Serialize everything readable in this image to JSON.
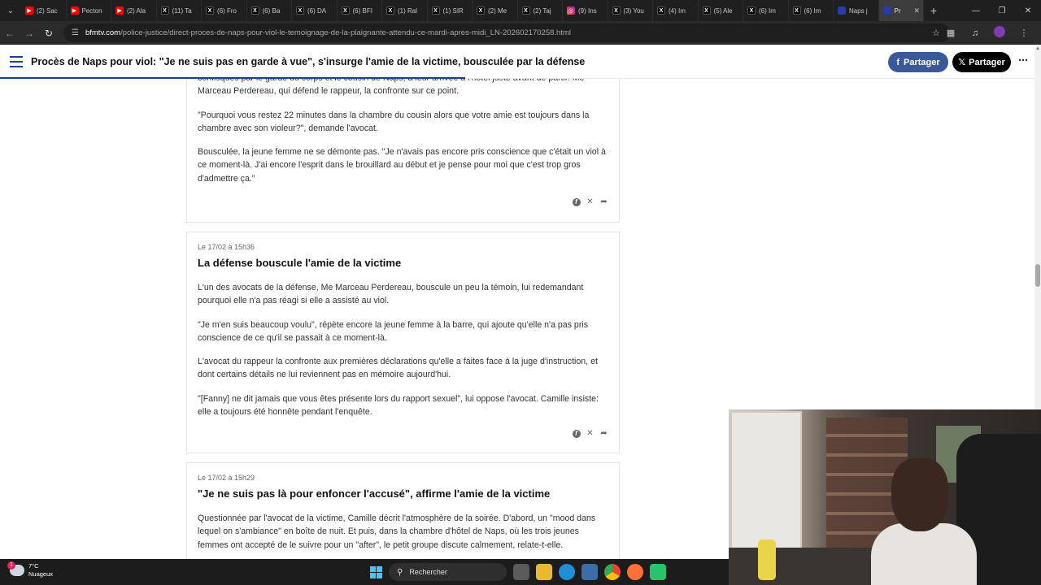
{
  "browser": {
    "tabs": [
      {
        "label": "(2) Sac",
        "favicon": "youtube-icon",
        "active": false
      },
      {
        "label": "Pecton",
        "favicon": "youtube-icon",
        "active": false
      },
      {
        "label": "(2) Ala",
        "favicon": "youtube-icon",
        "active": false
      },
      {
        "label": "(11) Ta",
        "favicon": "x-icon",
        "active": false
      },
      {
        "label": "(6) Fro",
        "favicon": "x-icon",
        "active": false
      },
      {
        "label": "(6) Ba",
        "favicon": "x-icon",
        "active": false
      },
      {
        "label": "(6) DA",
        "favicon": "x-icon",
        "active": false
      },
      {
        "label": "(6) BFI",
        "favicon": "x-icon",
        "active": false
      },
      {
        "label": "(1) Ral",
        "favicon": "x-icon",
        "active": false
      },
      {
        "label": "(1) SIR",
        "favicon": "x-icon",
        "active": false
      },
      {
        "label": "(2) Me",
        "favicon": "x-icon",
        "active": false
      },
      {
        "label": "(2) Taj",
        "favicon": "x-icon",
        "active": false
      },
      {
        "label": "(9) Ins",
        "favicon": "instagram-icon",
        "active": false
      },
      {
        "label": "(3) You",
        "favicon": "x-icon",
        "active": false
      },
      {
        "label": "(4) Im",
        "favicon": "x-icon",
        "active": false
      },
      {
        "label": "(5) Ale",
        "favicon": "x-icon",
        "active": false
      },
      {
        "label": "(6) Im",
        "favicon": "x-icon",
        "active": false
      },
      {
        "label": "(6) Im",
        "favicon": "x-icon",
        "active": false
      },
      {
        "label": "Naps j",
        "favicon": "bfm-icon",
        "active": false
      },
      {
        "label": "Pr",
        "favicon": "bfm-icon",
        "active": true
      }
    ],
    "url_host": "bfmtv.com",
    "url_path": "/police-justice/direct-proces-de-naps-pour-viol-le-temoignage-de-la-plaignante-attendu-ce-mardi-apres-midi_LN-202602170258.html"
  },
  "header": {
    "title": "Procès de Naps pour viol: \"Je ne suis pas en garde à vue\", s'insurge l'amie de la victime, bousculée par la défense",
    "share_facebook": "Partager",
    "share_x": "Partager",
    "reading_progress": 0.45
  },
  "posts": [
    {
      "time": "",
      "title": "",
      "paragraphs": [
        "confisqués par le garde du corps et le cousin de Naps, à leur arrivée à l'hôtel juste avant de partir. Me Marceau Perdereau, qui défend le rappeur, la confronte sur ce point.",
        "\"Pourquoi vous restez 22 minutes dans la chambre du cousin alors que votre amie est toujours dans la chambre avec son violeur?\", demande l'avocat.",
        "Bousculée, la jeune femme ne se démonte pas. \"Je n'avais pas encore pris conscience que c'était un viol à ce moment-là. J'ai encore l'esprit dans le brouillard au début et je pense pour moi que c'est trop gros d'admettre ça.\""
      ]
    },
    {
      "time": "Le 17/02 à 15h36",
      "title": "La défense bouscule l'amie de la victime",
      "paragraphs": [
        "L'un des avocats de la défense, Me Marceau Perdereau, bouscule un peu la témoin, lui redemandant pourquoi elle n'a pas réagi si elle a assisté au viol.",
        "\"Je m'en suis beaucoup voulu\", répète encore la jeune femme à la barre, qui ajoute qu'elle n'a pas pris conscience de ce qu'il se passait à ce moment-là.",
        "L'avocat du rappeur la confronte aux premières déclarations qu'elle a faites face à la juge d'instruction, et dont certains détails ne lui reviennent pas en mémoire aujourd'hui.",
        "\"[Fanny] ne dit jamais que vous êtes présente lors du rapport sexuel\", lui oppose l'avocat. Camille insiste: elle a toujours été honnête pendant l'enquête."
      ]
    },
    {
      "time": "Le 17/02 à 15h29",
      "title": "\"Je ne suis pas là pour enfoncer l'accusé\", affirme l'amie de la victime",
      "paragraphs": [
        "Questionnée par l'avocat de la victime, Camille décrit l'atmosphère de la soirée. D'abord, un \"mood dans lequel on s'ambiance\" en boîte de nuit. Et puis, dans la chambre d'hôtel de Naps, où les trois jeunes femmes ont accepté de le suivre pour un \"after\", le petit groupe discute calmement, relate-t-elle."
      ]
    }
  ],
  "taskbar": {
    "temperature": "7°C",
    "weather": "Nuageux",
    "weather_badge": "1",
    "search_label": "Rechercher"
  }
}
